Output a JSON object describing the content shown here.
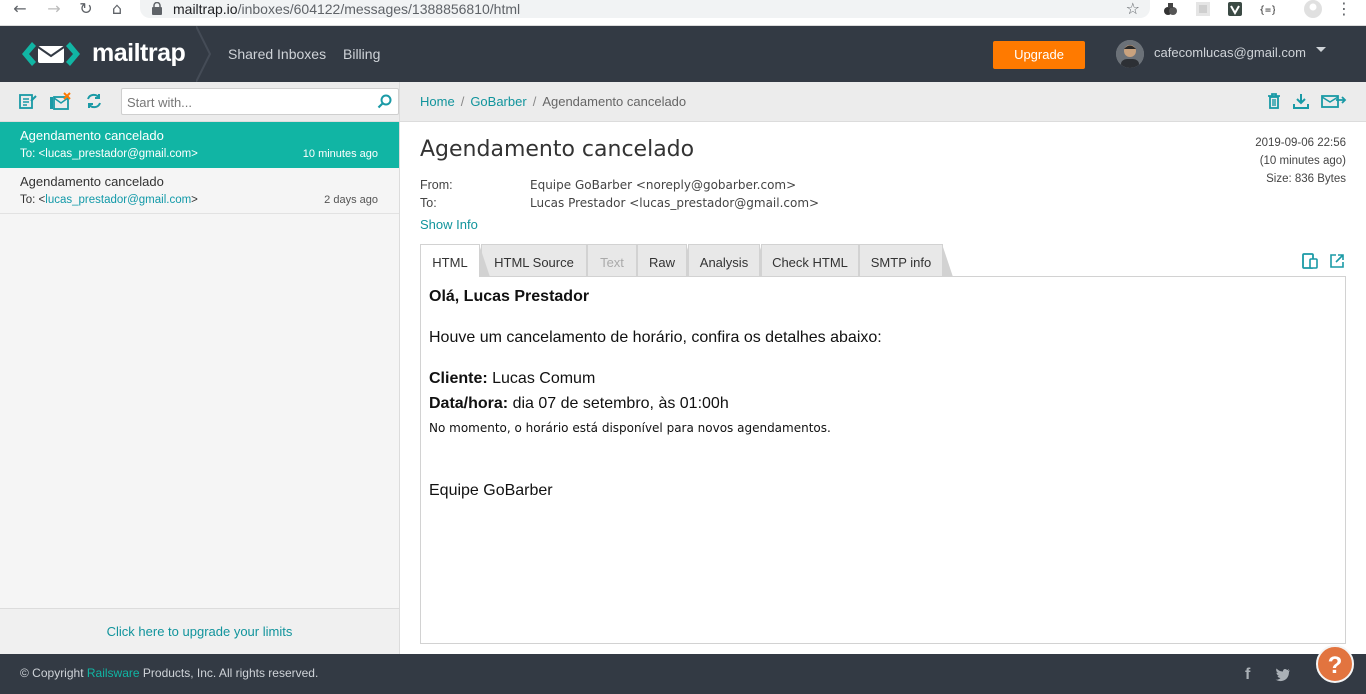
{
  "browser": {
    "url_host": "mailtrap.io",
    "url_path": "/inboxes/604122/messages/1388856810/html"
  },
  "header": {
    "logo_text": "mailtrap",
    "nav": [
      "Shared Inboxes",
      "Billing"
    ],
    "upgrade_label": "Upgrade",
    "user_email": "cafecomlucas@gmail.com"
  },
  "sidebar": {
    "search_placeholder": "Start with...",
    "messages": [
      {
        "subject": "Agendamento cancelado",
        "to_prefix": "To: <",
        "to_addr": "lucas_prestador@gmail.com",
        "to_suffix": ">",
        "time": "10 minutes ago",
        "active": true
      },
      {
        "subject": "Agendamento cancelado",
        "to_prefix": "To: <",
        "to_addr": "lucas_prestador@gmail.com",
        "to_suffix": ">",
        "time": "2 days ago",
        "active": false
      }
    ],
    "upgrade_limits": "Click here to upgrade your limits"
  },
  "breadcrumb": {
    "home": "Home",
    "inbox": "GoBarber",
    "current": "Agendamento cancelado",
    "separator": "/"
  },
  "message": {
    "title": "Agendamento cancelado",
    "date": "2019-09-06 22:56",
    "relative": "(10 minutes ago)",
    "size": "Size: 836 Bytes",
    "from_label": "From:",
    "from_value": "Equipe GoBarber <noreply@gobarber.com>",
    "to_label": "To:",
    "to_value": "Lucas Prestador <lucas_prestador@gmail.com>",
    "show_info": "Show Info"
  },
  "tabs": [
    {
      "label": "HTML",
      "state": "active"
    },
    {
      "label": "HTML Source",
      "state": "normal"
    },
    {
      "label": "Text",
      "state": "disabled"
    },
    {
      "label": "Raw",
      "state": "normal"
    },
    {
      "label": "Analysis",
      "state": "normal"
    },
    {
      "label": "Check HTML",
      "state": "normal"
    },
    {
      "label": "SMTP info",
      "state": "normal"
    }
  ],
  "email": {
    "greeting": "Olá, Lucas Prestador",
    "intro": "Houve um cancelamento de horário, confira os detalhes abaixo:",
    "client_label": "Cliente:",
    "client_value": " Lucas Comum",
    "datetime_label": "Data/hora:",
    "datetime_value": " dia 07 de setembro, às 01:00h",
    "note": "No momento, o horário está disponível para novos agendamentos.",
    "signature": "Equipe GoBarber"
  },
  "footer": {
    "copyright_prefix": "© Copyright ",
    "brand": "Railsware",
    "copyright_suffix": " Products, Inc. All rights reserved.",
    "facebook": "f",
    "help": "?"
  },
  "colors": {
    "accent": "#11b5a4",
    "header_bg": "#333a44",
    "upgrade": "#ff7a00",
    "link": "#11949c"
  }
}
